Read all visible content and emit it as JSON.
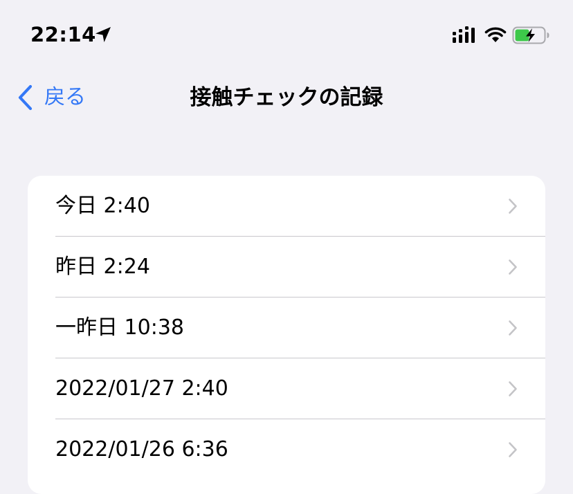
{
  "status_bar": {
    "time": "22:14",
    "icons": [
      "location-arrow-icon",
      "cellular-signal-icon",
      "wifi-icon",
      "battery-charging-icon"
    ],
    "battery_color": "#3dc84a"
  },
  "nav": {
    "back_label": "戻る",
    "title": "接触チェックの記録",
    "accent_color": "#3478f6"
  },
  "records": [
    {
      "label": "今日 2:40"
    },
    {
      "label": "昨日 2:24"
    },
    {
      "label": "一昨日 10:38"
    },
    {
      "label": "2022/01/27 2:40"
    },
    {
      "label": "2022/01/26 6:36"
    }
  ]
}
